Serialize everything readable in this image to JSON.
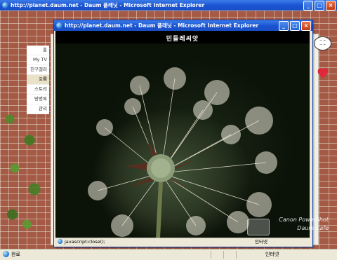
{
  "back_window": {
    "title": "http://planet.daum.net - Daum 플래닛 - Microsoft Internet Explorer",
    "menu": [
      "홈",
      "My TV",
      "친구갤러리",
      "포토",
      "스토리",
      "방명록",
      "관리"
    ],
    "active_menu_index": 3
  },
  "popup_window": {
    "title": "http://planet.daum.net - Daum 플래닛 - Microsoft Internet Explorer",
    "photo_title": "민들레씨앗",
    "status_text": "javascript:close();",
    "status_zone": "인터넷"
  },
  "watermark": {
    "line1": "Canon PowerShot",
    "line2": "Daum Cafe"
  },
  "statusbar": {
    "status_text": "완료",
    "zone_text": "인터넷"
  },
  "window_buttons": {
    "minimize": "_",
    "maximize": "□",
    "close": "×"
  },
  "colors": {
    "titlebar": "#1952d1",
    "close_button": "#c23b14"
  }
}
